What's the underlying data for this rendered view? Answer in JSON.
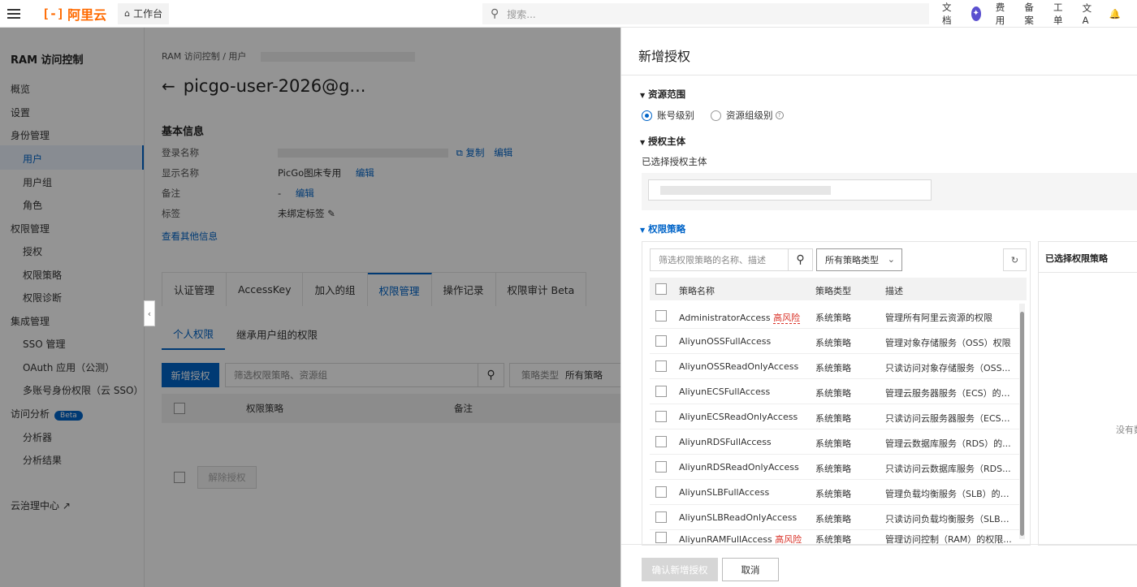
{
  "topbar": {
    "logo_mark": "[-]",
    "logo_text": "阿里云",
    "workbench": "工作台",
    "search_placeholder": "搜索...",
    "links": [
      "文档",
      "费用",
      "备案",
      "工单"
    ]
  },
  "sidebar": {
    "title": "RAM 访问控制",
    "items": [
      {
        "label": "概览",
        "level": "top"
      },
      {
        "label": "设置",
        "level": "top"
      },
      {
        "label": "身份管理",
        "level": "top"
      },
      {
        "label": "用户",
        "level": "sub",
        "active": true
      },
      {
        "label": "用户组",
        "level": "sub"
      },
      {
        "label": "角色",
        "level": "sub"
      },
      {
        "label": "权限管理",
        "level": "top"
      },
      {
        "label": "授权",
        "level": "sub"
      },
      {
        "label": "权限策略",
        "level": "sub"
      },
      {
        "label": "权限诊断",
        "level": "sub"
      },
      {
        "label": "集成管理",
        "level": "top"
      },
      {
        "label": "SSO 管理",
        "level": "sub"
      },
      {
        "label": "OAuth 应用（公测）",
        "level": "sub"
      },
      {
        "label": "多账号身份权限（云 SSO）",
        "level": "sub"
      },
      {
        "label": "访问分析",
        "level": "top"
      },
      {
        "label": "分析器",
        "level": "sub"
      },
      {
        "label": "分析结果",
        "level": "sub"
      },
      {
        "label": "云治理中心",
        "level": "top"
      }
    ],
    "beta_badge": "Beta"
  },
  "main": {
    "breadcrumb": [
      "RAM 访问控制",
      "用户"
    ],
    "title": "picgo-user-2026@g...",
    "basic_info": "基本信息",
    "fields": {
      "login_name_label": "登录名称",
      "display_name_label": "显示名称",
      "display_name_value": "PicGo图床专用",
      "remark_label": "备注",
      "remark_value": "-",
      "tag_label": "标签",
      "tag_value": "未绑定标签",
      "copy": "复制",
      "edit": "编辑"
    },
    "more_info": "查看其他信息",
    "tabs": [
      "认证管理",
      "AccessKey",
      "加入的组",
      "权限管理",
      "操作记录",
      "权限审计 Beta"
    ],
    "active_tab": "权限管理",
    "subtabs": [
      "个人权限",
      "继承用户组的权限"
    ],
    "add_button": "新增授权",
    "filter_placeholder": "筛选权限策略、资源组",
    "type_label": "策略类型",
    "type_value": "所有策略",
    "table_headers": [
      "权限策略",
      "备注"
    ],
    "revoke_button": "解除授权"
  },
  "drawer": {
    "title": "新增授权",
    "scope_section": "资源范围",
    "scope_options": [
      "账号级别",
      "资源组级别"
    ],
    "principal_section": "授权主体",
    "selected_principal_label": "已选择授权主体",
    "policy_section": "权限策略",
    "policy_search_placeholder": "筛选权限策略的名称、描述",
    "policy_type_select": "所有策略类型",
    "policy_headers": [
      "策略名称",
      "策略类型",
      "描述"
    ],
    "high_risk": "高风险",
    "policies": [
      {
        "name": "AdministratorAccess",
        "risk": true,
        "type": "系统策略",
        "desc": "管理所有阿里云资源的权限"
      },
      {
        "name": "AliyunOSSFullAccess",
        "risk": false,
        "type": "系统策略",
        "desc": "管理对象存储服务（OSS）权限"
      },
      {
        "name": "AliyunOSSReadOnlyAccess",
        "risk": false,
        "type": "系统策略",
        "desc": "只读访问对象存储服务（OSS..."
      },
      {
        "name": "AliyunECSFullAccess",
        "risk": false,
        "type": "系统策略",
        "desc": "管理云服务器服务（ECS）的权..."
      },
      {
        "name": "AliyunECSReadOnlyAccess",
        "risk": false,
        "type": "系统策略",
        "desc": "只读访问云服务器服务（ECS）..."
      },
      {
        "name": "AliyunRDSFullAccess",
        "risk": false,
        "type": "系统策略",
        "desc": "管理云数据库服务（RDS）的..."
      },
      {
        "name": "AliyunRDSReadOnlyAccess",
        "risk": false,
        "type": "系统策略",
        "desc": "只读访问云数据库服务（RDS..."
      },
      {
        "name": "AliyunSLBFullAccess",
        "risk": false,
        "type": "系统策略",
        "desc": "管理负载均衡服务（SLB）的权..."
      },
      {
        "name": "AliyunSLBReadOnlyAccess",
        "risk": false,
        "type": "系统策略",
        "desc": "只读访问负载均衡服务（SLB）..."
      },
      {
        "name": "AliyunRAMFullAccess",
        "risk": true,
        "type": "系统策略",
        "desc": "管理访问控制（RAM）的权限..."
      }
    ],
    "selected_policies_title": "已选择权限策略",
    "selected_empty": "没有数",
    "confirm_button": "确认新增授权",
    "cancel_button": "取消"
  }
}
